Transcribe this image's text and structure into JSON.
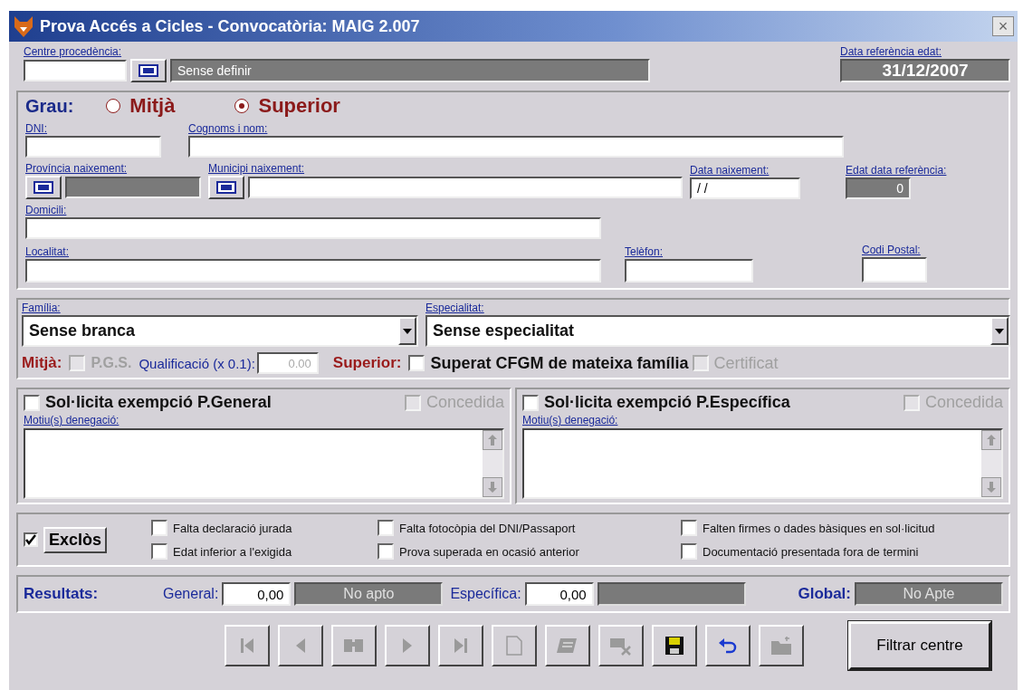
{
  "window": {
    "title": "Prova Accés a Cicles - Convocatòria: MAIG 2.007",
    "close": "×"
  },
  "centre": {
    "label": "Centre procedència:",
    "name": "Sense definir"
  },
  "data_referencia": {
    "label": "Data referència edat:",
    "value": "31/12/2007"
  },
  "grau": {
    "label": "Grau:",
    "options": [
      {
        "label": "Mitjà",
        "selected": false
      },
      {
        "label": "Superior",
        "selected": true
      }
    ]
  },
  "dni": {
    "label": "DNI:"
  },
  "nom": {
    "label": "Cognoms i nom:"
  },
  "provincia": {
    "label": "Província naixement:"
  },
  "municipi": {
    "label": "Municipi naixement:"
  },
  "data_naixement": {
    "label": "Data naixement:",
    "value": "/ /"
  },
  "edat": {
    "label": "Edat data referència:",
    "value": "0"
  },
  "domicili": {
    "label": "Domicili:"
  },
  "localitat": {
    "label": "Localitat:"
  },
  "telefon": {
    "label": "Telèfon:"
  },
  "codi_postal": {
    "label": "Codi Postal:"
  },
  "familia": {
    "label": "Família:",
    "value": "Sense branca"
  },
  "especialitat": {
    "label": "Especialitat:",
    "value": "Sense especialitat"
  },
  "mitja": {
    "label": "Mitjà:",
    "pgs": {
      "label": "P.G.S.",
      "checked": false,
      "disabled": true
    },
    "qualificacio": {
      "label": "Qualificació (x 0.1):",
      "value": "0.00",
      "disabled": true
    }
  },
  "superior": {
    "label": "Superior:",
    "superat": {
      "label": "Superat CFGM de mateixa família",
      "checked": false,
      "disabled": false
    },
    "certificat": {
      "label": "Certificat",
      "checked": false,
      "disabled": true
    }
  },
  "exemptions": [
    {
      "label": "Sol·licita exempció P.General",
      "checked": false,
      "granted": {
        "label": "Concedida",
        "checked": false,
        "disabled": true
      },
      "reason_label": "Motiu(s) denegació:"
    },
    {
      "label": "Sol·licita exempció P.Específica",
      "checked": false,
      "granted": {
        "label": "Concedida",
        "checked": false,
        "disabled": true
      },
      "reason_label": "Motiu(s) denegació:"
    }
  ],
  "exclos": {
    "label": "Exclòs",
    "checked": true
  },
  "reasons": [
    {
      "label": "Falta declaració jurada",
      "checked": false
    },
    {
      "label": "Falta fotocòpia del DNI/Passaport",
      "checked": false
    },
    {
      "label": "Falten firmes o dades bàsiques en sol·licitud",
      "checked": false
    },
    {
      "label": "Edat inferior a l'exigida",
      "checked": false
    },
    {
      "label": "Prova superada en ocasió anterior",
      "checked": false
    },
    {
      "label": "Documentació presentada fora de termini",
      "checked": false
    }
  ],
  "resultats": {
    "label": "Resultats:",
    "general": {
      "label": "General:",
      "score": "0,00",
      "verdict": "No apto"
    },
    "especifica": {
      "label": "Específica:",
      "score": "0,00"
    },
    "global": {
      "label": "Global:",
      "verdict": "No Apte"
    }
  },
  "toolbar": [
    {
      "kind": "first",
      "disabled": true
    },
    {
      "kind": "prev",
      "disabled": true
    },
    {
      "kind": "search",
      "disabled": true
    },
    {
      "kind": "next",
      "disabled": true
    },
    {
      "kind": "last",
      "disabled": true
    },
    {
      "kind": "new",
      "disabled": true
    },
    {
      "kind": "edit",
      "disabled": true
    },
    {
      "kind": "delete",
      "disabled": true
    },
    {
      "kind": "save",
      "disabled": false
    },
    {
      "kind": "undo",
      "disabled": false
    },
    {
      "kind": "folder",
      "disabled": true
    }
  ],
  "filter_button": "Filtrar centre"
}
